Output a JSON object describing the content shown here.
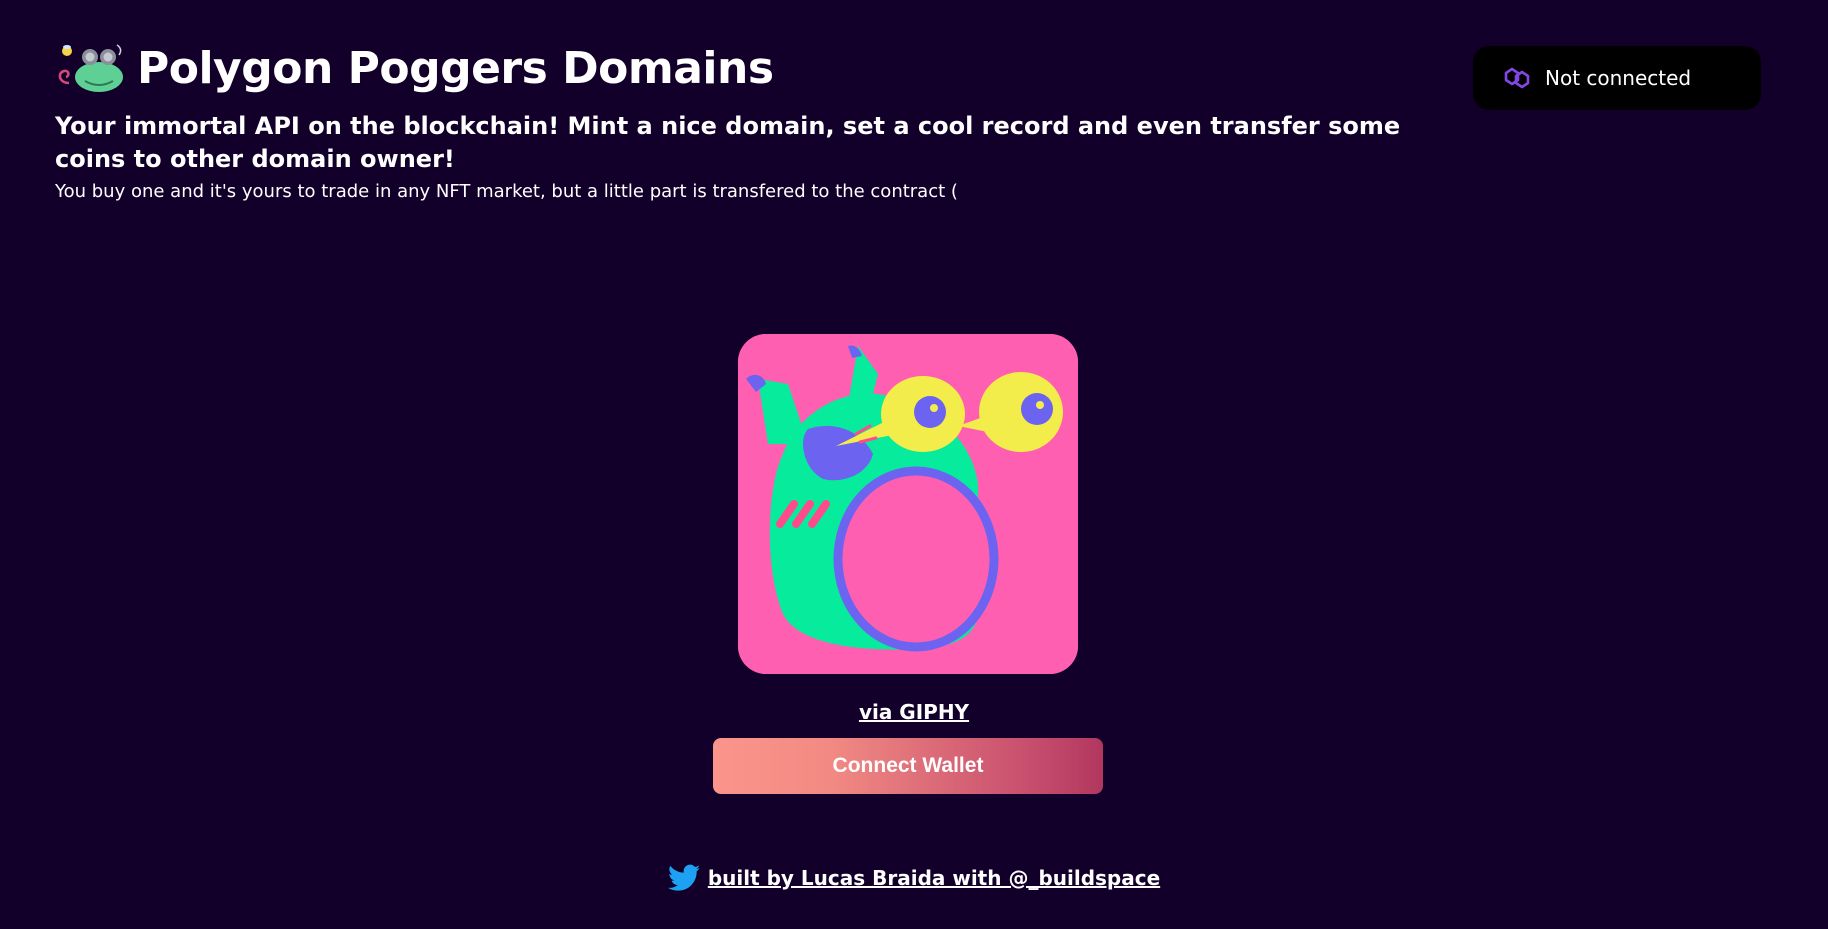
{
  "header": {
    "title": "Polygon Poggers Domains",
    "tagline": "Your immortal API on the blockchain! Mint a nice domain, set a cool record and even transfer some coins to other domain owner!",
    "subtext": "You buy one and it's yours to trade in any NFT market, but a little part is transfered to the contract ("
  },
  "wallet_status": {
    "icon": "polygon-icon",
    "label": "Not connected"
  },
  "media": {
    "giphy_link": "via GIPHY"
  },
  "actions": {
    "connect_label": "Connect Wallet"
  },
  "footer": {
    "icon": "twitter-icon",
    "link_text": "built by Lucas Braida with @_buildspace"
  },
  "colors": {
    "background": "#12002a",
    "wallet_badge_bg": "#000000",
    "button_gradient_start": "#fb958b",
    "button_gradient_end": "#b23760",
    "gif_bg": "#ff5fb0"
  }
}
